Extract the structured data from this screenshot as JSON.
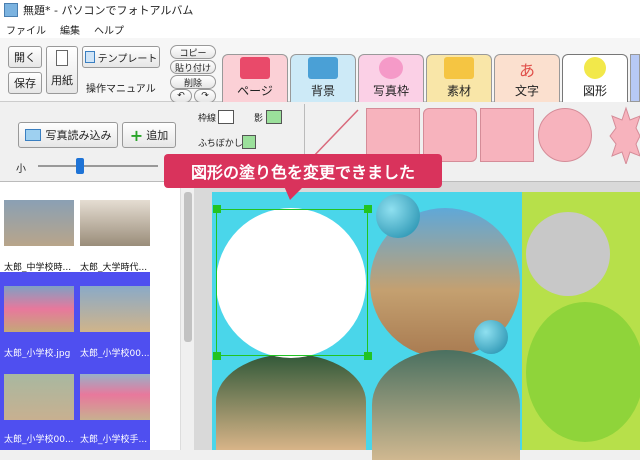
{
  "title": "無題* - パソコンでフォトアルバム",
  "menu": [
    "ファイル",
    "編集",
    "ヘルプ"
  ],
  "toolbar": {
    "open": "開く",
    "save": "保存",
    "paper": "用紙",
    "template": "テンプレート",
    "manual": "操作マニュアル",
    "copy": "コピー",
    "paste": "貼り付け",
    "delete": "削除"
  },
  "tabs": [
    "ページ",
    "背景",
    "写真枠",
    "素材",
    "文字",
    "図形"
  ],
  "shape_tools": {
    "border_label": "枠線",
    "shadow_label": "影",
    "blur_label": "ふちぼかし"
  },
  "photo_panel": {
    "load_button": "写真読み込み",
    "add_button": "追加",
    "zoom_small": "小"
  },
  "thumbnails": [
    {
      "caption": "太郎_中学校時..."
    },
    {
      "caption": "太郎_大学時代..."
    },
    {
      "caption": "太郎_小学校.jpg"
    },
    {
      "caption": "太郎_小学校00..."
    },
    {
      "caption": "太郎_小学校00..."
    },
    {
      "caption": "太郎_小学校手..."
    }
  ],
  "tooltip": "図形の塗り色を変更できました",
  "colors": {
    "canvas_left": "#4ad6ea",
    "canvas_right": "#b7e04a",
    "swatch_pink": "#f7b3bd",
    "tooltip": "#d9335c",
    "selection": "#22c422"
  }
}
